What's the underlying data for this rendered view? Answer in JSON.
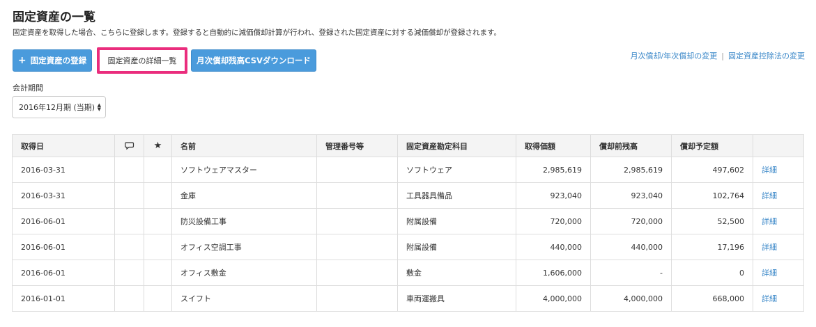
{
  "page": {
    "title": "固定資産の一覧",
    "description": "固定資産を取得した場合、こちらに登録します。登録すると自動的に減価償却計算が行われ、登録された固定資産に対する減価償却が登録されます。"
  },
  "toolbar": {
    "register_icon": "plus-icon",
    "register_label": "固定資産の登録",
    "detail_list_label": "固定資産の詳細一覧",
    "csv_download_label": "月次償却残高CSVダウンロード",
    "highlight_color": "#ea2d7d",
    "primary_color": "#4a9bdc"
  },
  "links": {
    "change_depreciation": "月次償却/年次償却の変更",
    "separator": "|",
    "change_deduction": "固定資産控除法の変更",
    "link_color": "#3a87c8"
  },
  "period": {
    "label": "会計期間",
    "selected": "2016年12月期 (当期)"
  },
  "table": {
    "headers": {
      "acquired_date": "取得日",
      "comment_icon": "comment-icon",
      "star_icon": "star-icon",
      "name": "名前",
      "management_no": "管理番号等",
      "account": "固定資産勘定科目",
      "acquisition_price": "取得価額",
      "pre_depreciation_balance": "償却前残高",
      "planned_depreciation": "償却予定額",
      "detail": ""
    },
    "rows": [
      {
        "date": "2016-03-31",
        "name": "ソフトウェアマスター",
        "management_no": "",
        "account": "ソフトウェア",
        "price": "2,985,619",
        "balance": "2,985,619",
        "planned": "497,602",
        "detail": "詳細"
      },
      {
        "date": "2016-03-31",
        "name": "金庫",
        "management_no": "",
        "account": "工具器具備品",
        "price": "923,040",
        "balance": "923,040",
        "planned": "102,764",
        "detail": "詳細"
      },
      {
        "date": "2016-06-01",
        "name": "防災設備工事",
        "management_no": "",
        "account": "附属設備",
        "price": "720,000",
        "balance": "720,000",
        "planned": "52,500",
        "detail": "詳細"
      },
      {
        "date": "2016-06-01",
        "name": "オフィス空調工事",
        "management_no": "",
        "account": "附属設備",
        "price": "440,000",
        "balance": "440,000",
        "planned": "17,196",
        "detail": "詳細"
      },
      {
        "date": "2016-06-01",
        "name": "オフィス敷金",
        "management_no": "",
        "account": "敷金",
        "price": "1,606,000",
        "balance": "-",
        "planned": "0",
        "detail": "詳細"
      },
      {
        "date": "2016-01-01",
        "name": "スイフト",
        "management_no": "",
        "account": "車両運搬具",
        "price": "4,000,000",
        "balance": "4,000,000",
        "planned": "668,000",
        "detail": "詳細"
      }
    ]
  }
}
